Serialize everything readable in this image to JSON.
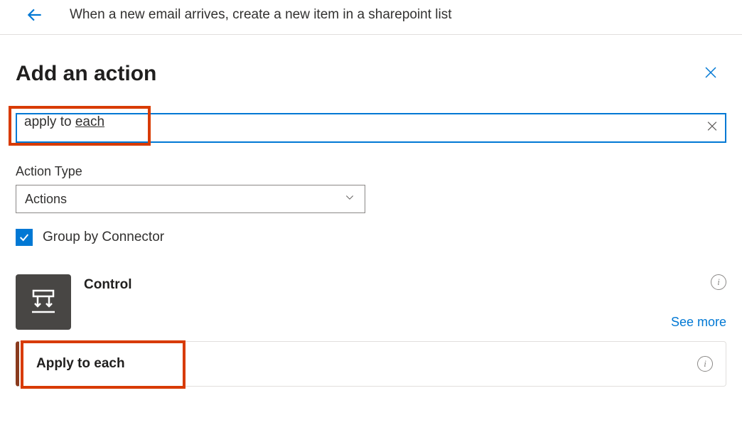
{
  "header": {
    "title": "When a new email arrives, create a new item in a sharepoint list"
  },
  "page": {
    "title": "Add an action"
  },
  "search": {
    "value_prefix": "apply to ",
    "value_underlined": "each",
    "full_value": "apply to each"
  },
  "action_type": {
    "label": "Action Type",
    "selected": "Actions"
  },
  "group_by": {
    "label": "Group by Connector",
    "checked": true
  },
  "connector": {
    "name": "Control",
    "see_more": "See more"
  },
  "actions": [
    {
      "label": "Apply to each"
    }
  ],
  "colors": {
    "accent": "#0078d4",
    "highlight": "#d83b01"
  }
}
